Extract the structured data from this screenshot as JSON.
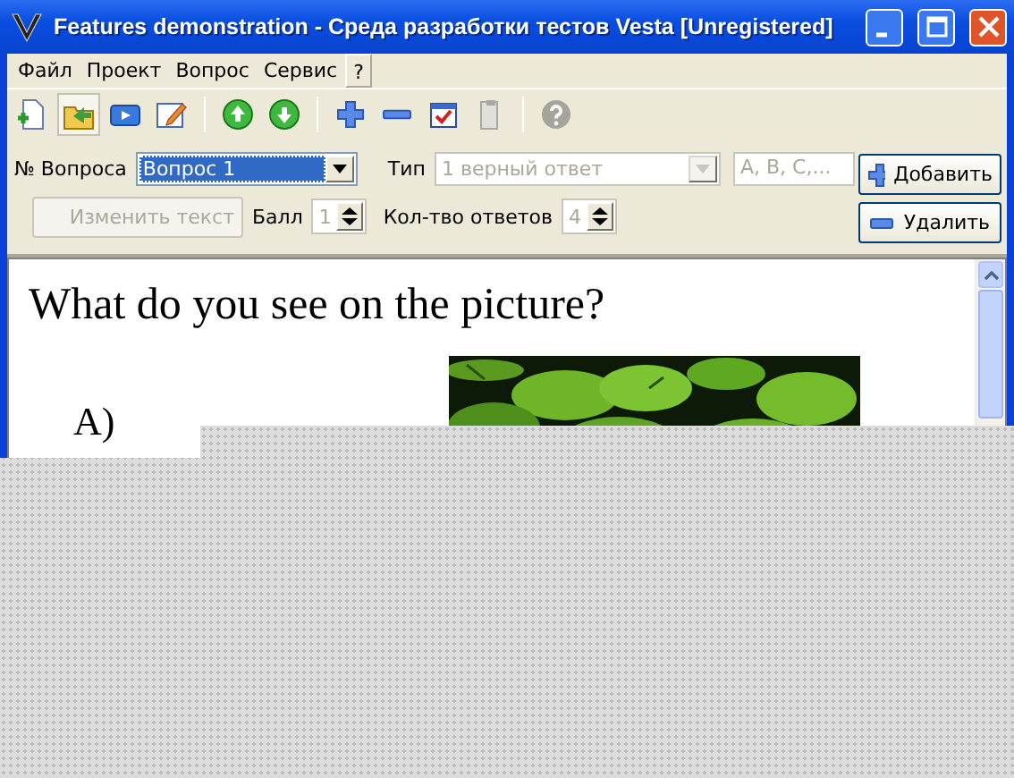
{
  "window": {
    "title": "Features demonstration - Среда разработки тестов Vesta [Unregistered]"
  },
  "menu": [
    {
      "label": "Файл",
      "selected": false
    },
    {
      "label": "Проект",
      "selected": false
    },
    {
      "label": "Вопрос",
      "selected": false
    },
    {
      "label": "Сервис",
      "selected": false
    },
    {
      "label": "?",
      "selected": true
    }
  ],
  "toolbar": [
    {
      "pressed": false,
      "disabled": false
    },
    {
      "pressed": true,
      "disabled": false
    },
    {
      "pressed": false,
      "disabled": false
    },
    {
      "pressed": false,
      "disabled": false
    },
    {
      "pressed": false,
      "disabled": false
    },
    {
      "pressed": false,
      "disabled": false
    },
    {
      "pressed": false,
      "disabled": false
    },
    {
      "pressed": false,
      "disabled": false
    },
    {
      "pressed": false,
      "disabled": false
    },
    {
      "pressed": false,
      "disabled": true
    },
    {
      "pressed": false,
      "disabled": true
    }
  ],
  "form": {
    "question_number": {
      "label": "№ Вопроса",
      "value": "Вопрос 1",
      "disabled": false
    },
    "type": {
      "label": "Тип",
      "value": "1 верный ответ",
      "disabled": true
    },
    "answer_labels": {
      "value": "A, B, C,...",
      "disabled": true
    },
    "add_button": {
      "label": "Добавить"
    },
    "edit_text_button": {
      "label": "Изменить текст",
      "disabled": true
    },
    "score": {
      "label": "Балл",
      "value": "1",
      "disabled": true
    },
    "answers_count": {
      "label": "Кол-тво ответов",
      "value": "4",
      "disabled": true
    },
    "delete_button": {
      "label": "Удалить"
    }
  },
  "content": {
    "question": "What do you see on the picture?",
    "answer_marker": "A)"
  }
}
